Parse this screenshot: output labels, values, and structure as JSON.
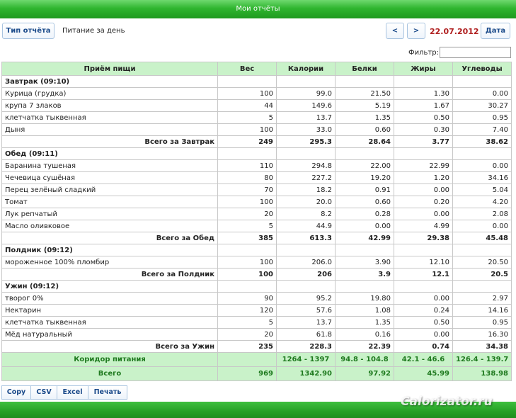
{
  "window": {
    "title": "Мои отчёты"
  },
  "toolbar": {
    "report_type_label": "Тип отчёта",
    "report_title": "Питание за день",
    "prev_label": "<",
    "next_label": ">",
    "date": "22.07.2012",
    "date_button_label": "Дата"
  },
  "filter": {
    "label": "Фильтр:",
    "value": ""
  },
  "table": {
    "headers": [
      "Приём пищи",
      "Вес",
      "Калории",
      "Белки",
      "Жиры",
      "Углеводы"
    ],
    "groups": [
      {
        "name": "Завтрак (09:10)",
        "items": [
          [
            "Курица (грудка)",
            "100",
            "99.0",
            "21.50",
            "1.30",
            "0.00"
          ],
          [
            "крупа 7 злаков",
            "44",
            "149.6",
            "5.19",
            "1.67",
            "30.27"
          ],
          [
            "клетчатка тыквенная",
            "5",
            "13.7",
            "1.35",
            "0.50",
            "0.95"
          ],
          [
            "Дыня",
            "100",
            "33.0",
            "0.60",
            "0.30",
            "7.40"
          ]
        ],
        "total": [
          "Всего за Завтрак",
          "249",
          "295.3",
          "28.64",
          "3.77",
          "38.62"
        ]
      },
      {
        "name": "Обед (09:11)",
        "items": [
          [
            "Баранина тушеная",
            "110",
            "294.8",
            "22.00",
            "22.99",
            "0.00"
          ],
          [
            "Чечевица сушёная",
            "80",
            "227.2",
            "19.20",
            "1.20",
            "34.16"
          ],
          [
            "Перец зелёный сладкий",
            "70",
            "18.2",
            "0.91",
            "0.00",
            "5.04"
          ],
          [
            "Томат",
            "100",
            "20.0",
            "0.60",
            "0.20",
            "4.20"
          ],
          [
            "Лук репчатый",
            "20",
            "8.2",
            "0.28",
            "0.00",
            "2.08"
          ],
          [
            "Масло оливковое",
            "5",
            "44.9",
            "0.00",
            "4.99",
            "0.00"
          ]
        ],
        "total": [
          "Всего за Обед",
          "385",
          "613.3",
          "42.99",
          "29.38",
          "45.48"
        ]
      },
      {
        "name": "Полдник (09:12)",
        "items": [
          [
            "мороженное 100% пломбир",
            "100",
            "206.0",
            "3.90",
            "12.10",
            "20.50"
          ]
        ],
        "total": [
          "Всего за Полдник",
          "100",
          "206",
          "3.9",
          "12.1",
          "20.5"
        ]
      },
      {
        "name": "Ужин (09:12)",
        "items": [
          [
            "творог 0%",
            "90",
            "95.2",
            "19.80",
            "0.00",
            "2.97"
          ],
          [
            "Нектарин",
            "120",
            "57.6",
            "1.08",
            "0.24",
            "14.16"
          ],
          [
            "клетчатка тыквенная",
            "5",
            "13.7",
            "1.35",
            "0.50",
            "0.95"
          ],
          [
            "Мёд натуральный",
            "20",
            "61.8",
            "0.16",
            "0.00",
            "16.30"
          ]
        ],
        "total": [
          "Всего за Ужин",
          "235",
          "228.3",
          "22.39",
          "0.74",
          "34.38"
        ]
      }
    ],
    "corridor": [
      "Коридор питания",
      "",
      "1264 - 1397",
      "94.8 - 104.8",
      "42.1 - 46.6",
      "126.4 - 139.7"
    ],
    "grand_total": [
      "Всего",
      "969",
      "1342.90",
      "97.92",
      "45.99",
      "138.98"
    ]
  },
  "export": {
    "buttons": [
      "Copy",
      "CSV",
      "Excel",
      "Печать"
    ]
  },
  "watermark": "Calorizator.ru"
}
